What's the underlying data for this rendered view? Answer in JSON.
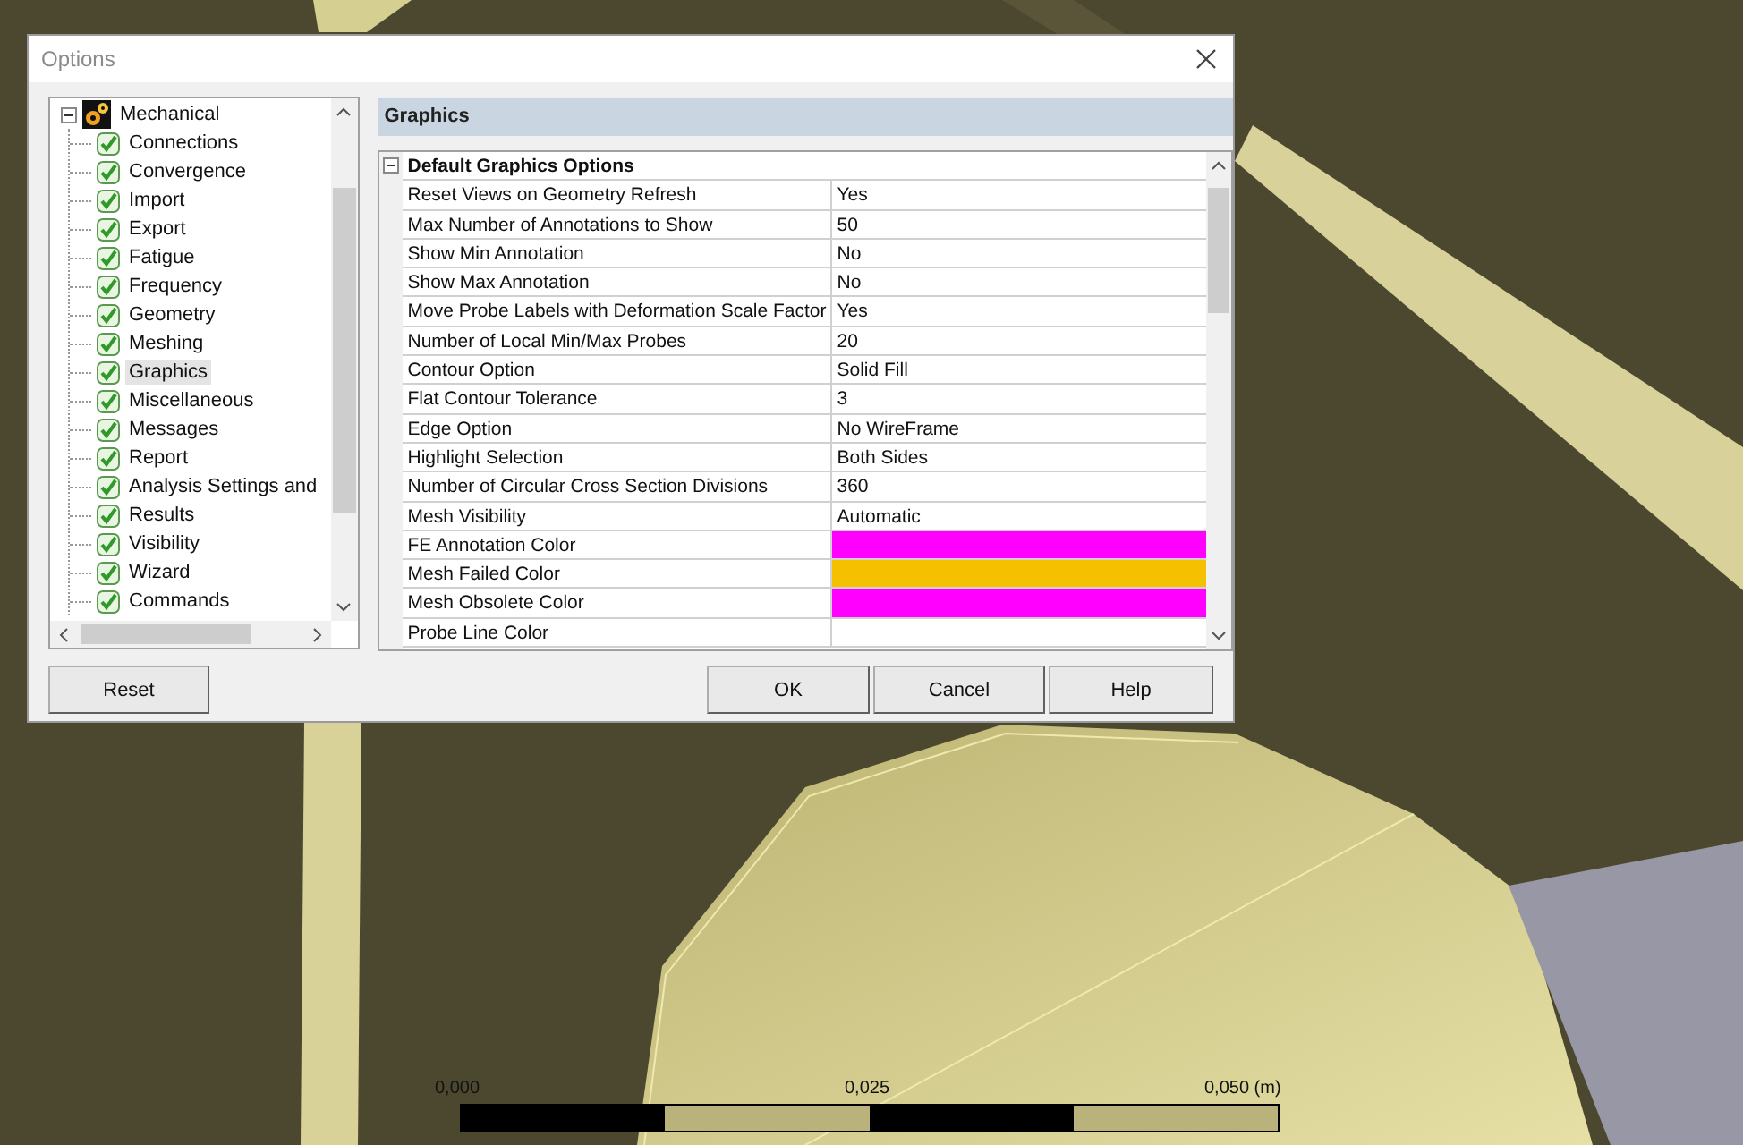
{
  "window": {
    "title": "Options"
  },
  "tree": {
    "root": {
      "label": "Mechanical",
      "expanded": true
    },
    "items": [
      {
        "label": "Connections",
        "selected": false
      },
      {
        "label": "Convergence",
        "selected": false
      },
      {
        "label": "Import",
        "selected": false
      },
      {
        "label": "Export",
        "selected": false
      },
      {
        "label": "Fatigue",
        "selected": false
      },
      {
        "label": "Frequency",
        "selected": false
      },
      {
        "label": "Geometry",
        "selected": false
      },
      {
        "label": "Meshing",
        "selected": false
      },
      {
        "label": "Graphics",
        "selected": true
      },
      {
        "label": "Miscellaneous",
        "selected": false
      },
      {
        "label": "Messages",
        "selected": false
      },
      {
        "label": "Report",
        "selected": false
      },
      {
        "label": "Analysis Settings and",
        "selected": false
      },
      {
        "label": "Results",
        "selected": false
      },
      {
        "label": "Visibility",
        "selected": false
      },
      {
        "label": "Wizard",
        "selected": false
      },
      {
        "label": "Commands",
        "selected": false
      }
    ]
  },
  "panel": {
    "title": "Graphics"
  },
  "grid": {
    "group": {
      "label": "Default Graphics Options",
      "expanded": true
    },
    "rows": [
      {
        "kind": "text",
        "name": "Reset Views on Geometry Refresh",
        "value": "Yes"
      },
      {
        "kind": "text",
        "name": "Max Number of Annotations to Show",
        "value": "50"
      },
      {
        "kind": "text",
        "name": "Show Min Annotation",
        "value": "No"
      },
      {
        "kind": "text",
        "name": "Show Max Annotation",
        "value": "No"
      },
      {
        "kind": "text",
        "name": "Move Probe Labels with Deformation Scale Factor",
        "value": "Yes"
      },
      {
        "kind": "text",
        "name": "Number of Local Min/Max Probes",
        "value": "20"
      },
      {
        "kind": "text",
        "name": "Contour Option",
        "value": "Solid Fill"
      },
      {
        "kind": "text",
        "name": "Flat Contour Tolerance",
        "value": "3"
      },
      {
        "kind": "text",
        "name": "Edge Option",
        "value": "No WireFrame"
      },
      {
        "kind": "text",
        "name": "Highlight Selection",
        "value": "Both Sides"
      },
      {
        "kind": "text",
        "name": "Number of Circular Cross Section Divisions",
        "value": "360"
      },
      {
        "kind": "text",
        "name": "Mesh Visibility",
        "value": "Automatic"
      },
      {
        "kind": "color",
        "name": "FE Annotation Color",
        "color": "#ff00ff"
      },
      {
        "kind": "color",
        "name": "Mesh Failed Color",
        "color": "#f5c000"
      },
      {
        "kind": "color",
        "name": "Mesh Obsolete Color",
        "color": "#ff00ff"
      },
      {
        "kind": "color",
        "name": "Probe Line Color",
        "color": "#ffffff"
      }
    ]
  },
  "buttons": [
    {
      "label": "Reset"
    },
    {
      "label": "OK"
    },
    {
      "label": "Cancel"
    },
    {
      "label": "Help"
    }
  ],
  "scale_bar": {
    "labels": [
      "0,000",
      "0,025",
      "0,050 (m)"
    ]
  }
}
